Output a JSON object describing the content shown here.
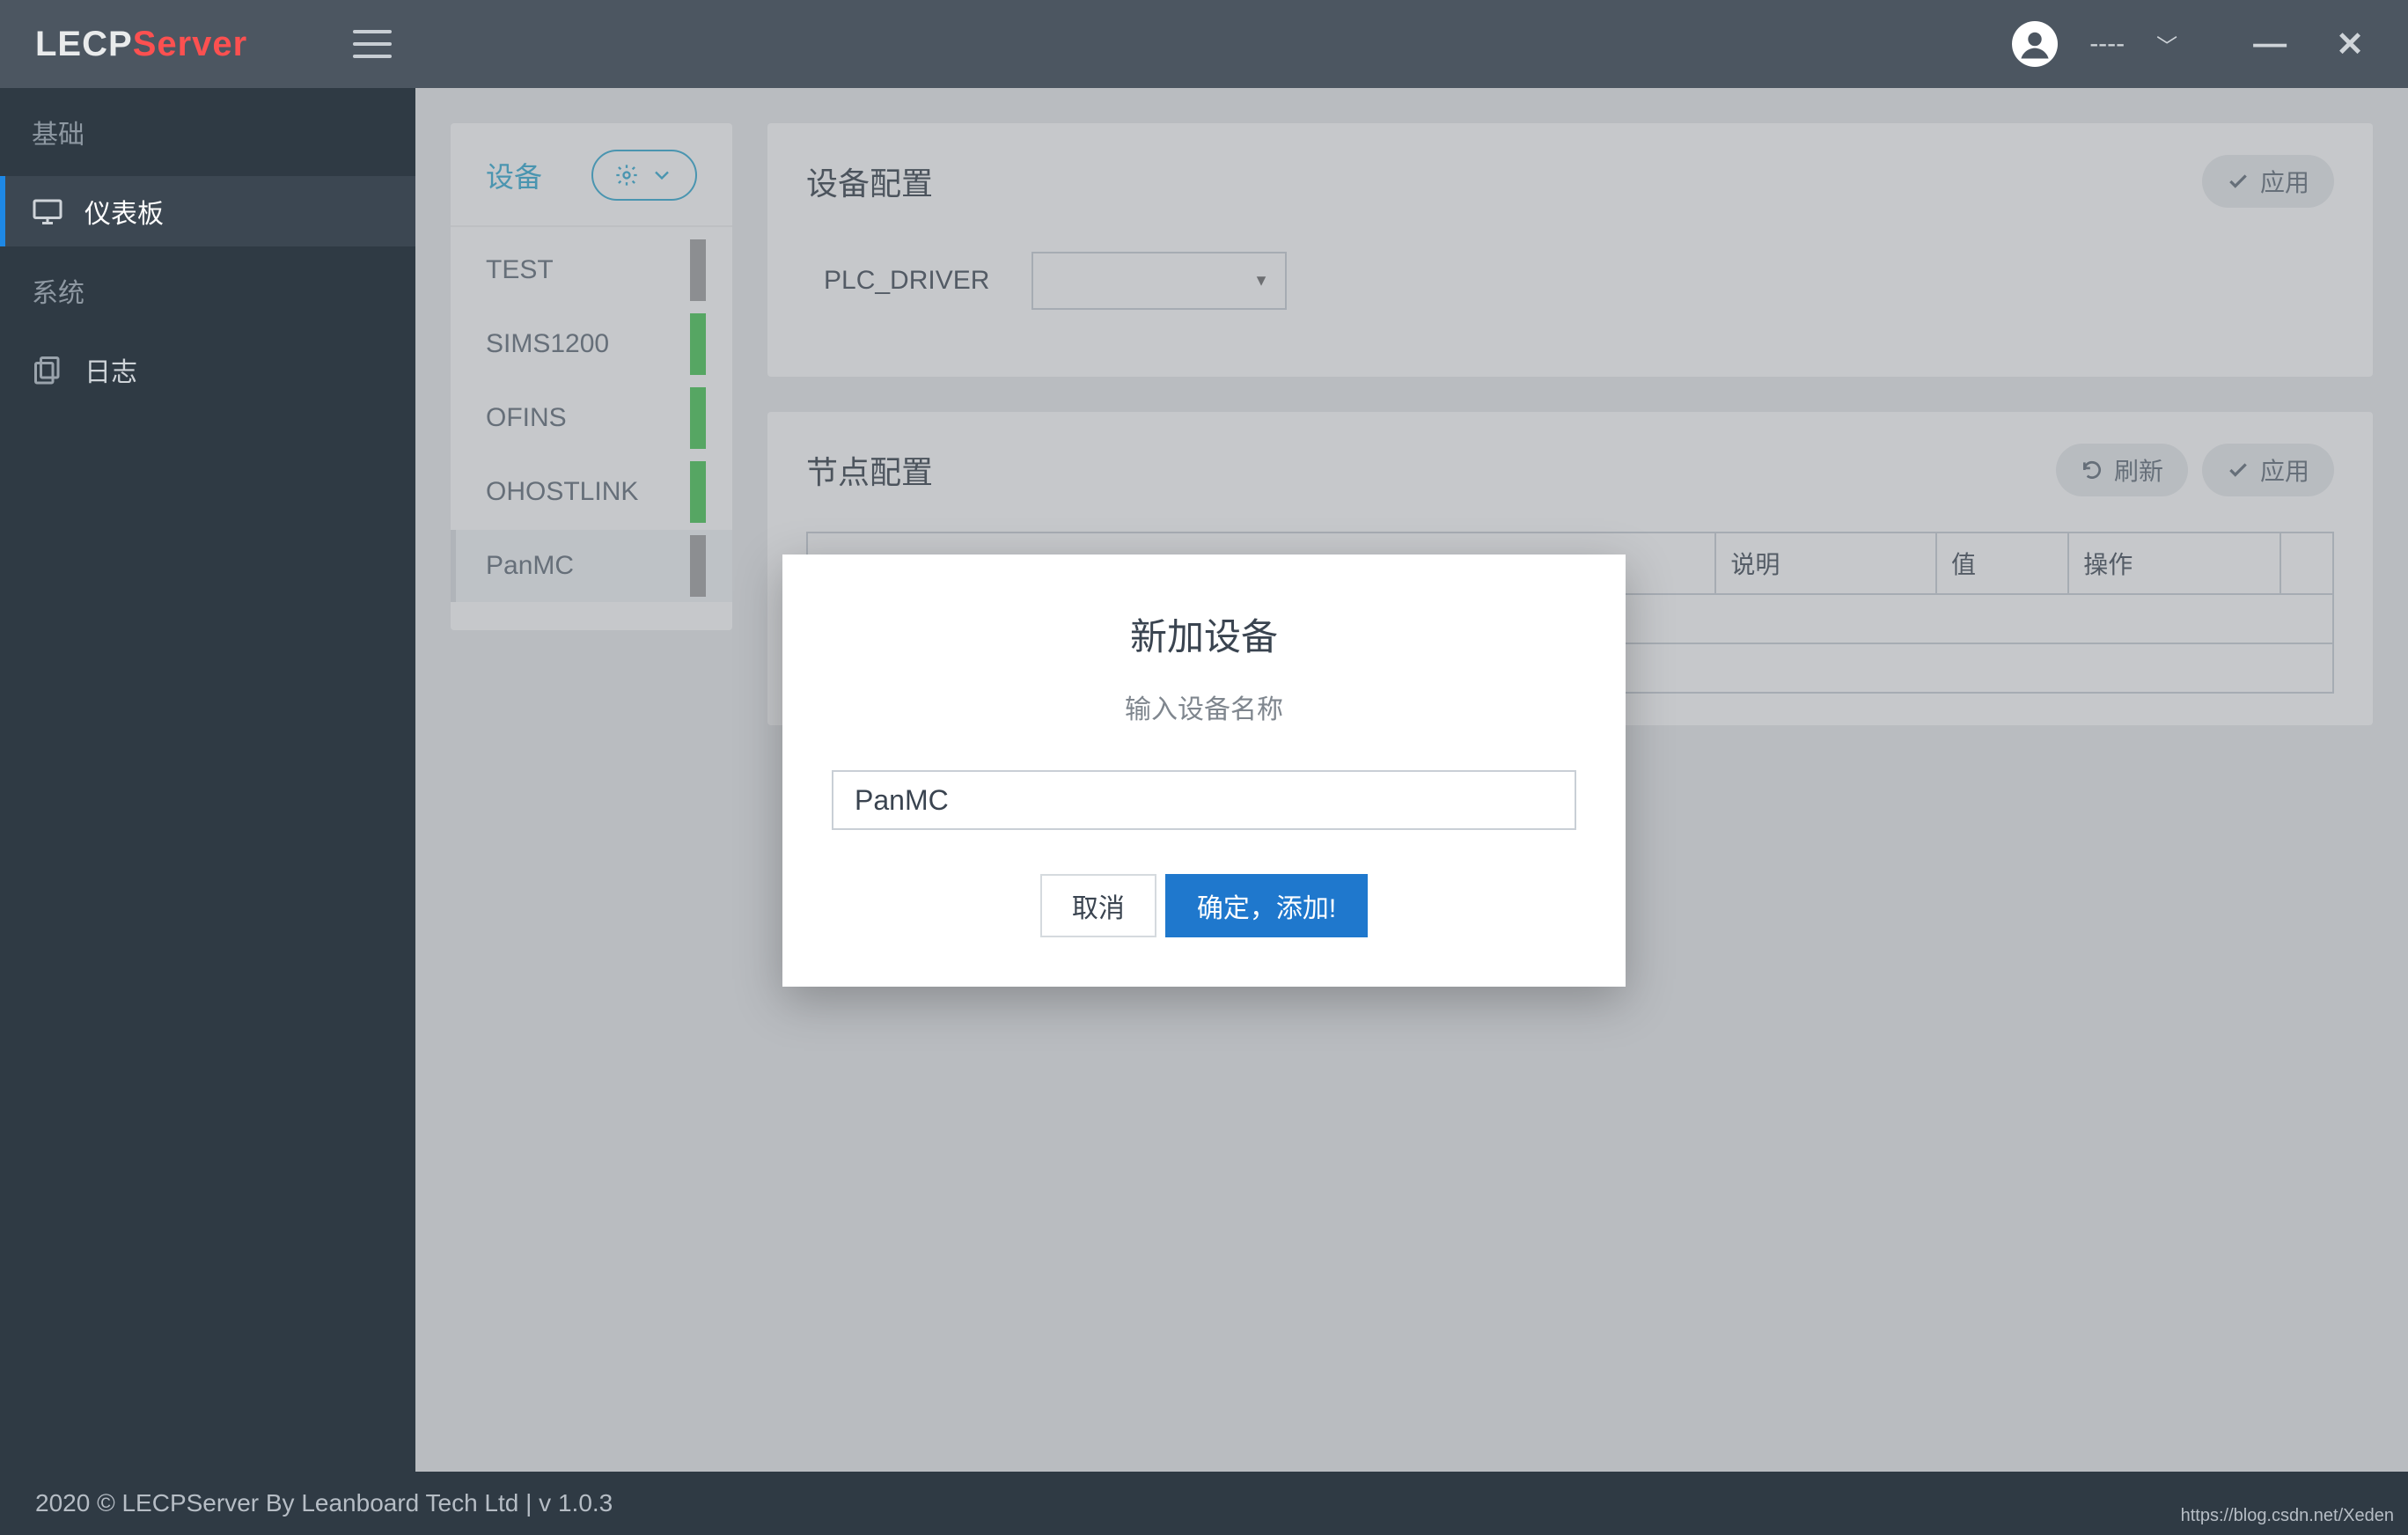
{
  "header": {
    "brand_a": "LECP",
    "brand_b": "Server",
    "username": "----"
  },
  "sidebar": {
    "section_basic": "基础",
    "item_dashboard": "仪表板",
    "section_system": "系统",
    "item_log": "日志"
  },
  "devpanel": {
    "title": "设备",
    "items": [
      {
        "name": "TEST",
        "status": "gray"
      },
      {
        "name": "SIMS1200",
        "status": "green"
      },
      {
        "name": "OFINS",
        "status": "green"
      },
      {
        "name": "OHOSTLINK",
        "status": "green"
      },
      {
        "name": "PanMC",
        "status": "gray"
      }
    ]
  },
  "config": {
    "title": "设备配置",
    "apply": "应用",
    "field_driver": "PLC_DRIVER"
  },
  "nodes": {
    "title": "节点配置",
    "refresh": "刷新",
    "apply": "应用",
    "columns": {
      "desc": "说明",
      "value": "值",
      "op": "操作"
    }
  },
  "modal": {
    "title": "新加设备",
    "subtitle": "输入设备名称",
    "value": "PanMC",
    "cancel": "取消",
    "confirm": "确定，添加!"
  },
  "footer": {
    "text": "2020 © LECPServer By Leanboard Tech Ltd   |   v 1.0.3",
    "watermark": "https://blog.csdn.net/Xeden"
  }
}
